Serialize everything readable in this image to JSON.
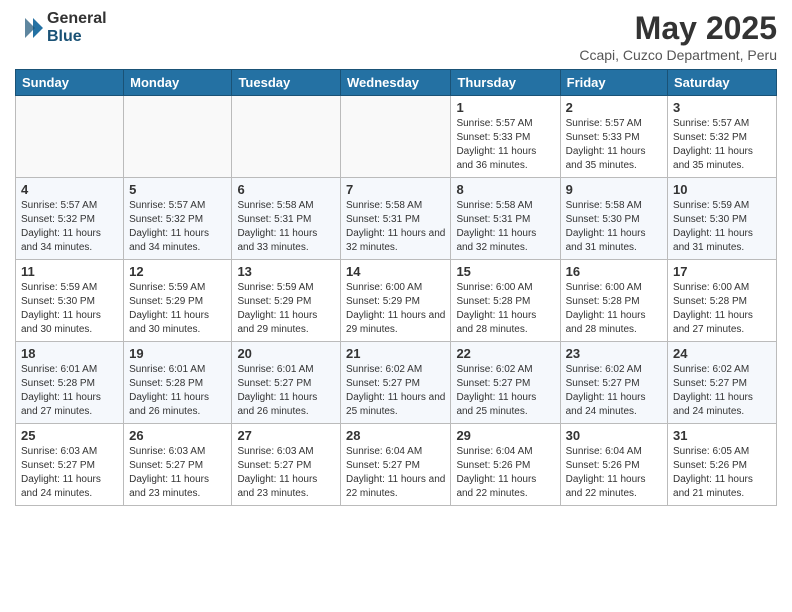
{
  "header": {
    "logo_general": "General",
    "logo_blue": "Blue",
    "month_title": "May 2025",
    "location": "Ccapi, Cuzco Department, Peru"
  },
  "weekdays": [
    "Sunday",
    "Monday",
    "Tuesday",
    "Wednesday",
    "Thursday",
    "Friday",
    "Saturday"
  ],
  "weeks": [
    [
      {
        "day": "",
        "info": ""
      },
      {
        "day": "",
        "info": ""
      },
      {
        "day": "",
        "info": ""
      },
      {
        "day": "",
        "info": ""
      },
      {
        "day": "1",
        "info": "Sunrise: 5:57 AM\nSunset: 5:33 PM\nDaylight: 11 hours\nand 36 minutes."
      },
      {
        "day": "2",
        "info": "Sunrise: 5:57 AM\nSunset: 5:33 PM\nDaylight: 11 hours\nand 35 minutes."
      },
      {
        "day": "3",
        "info": "Sunrise: 5:57 AM\nSunset: 5:32 PM\nDaylight: 11 hours\nand 35 minutes."
      }
    ],
    [
      {
        "day": "4",
        "info": "Sunrise: 5:57 AM\nSunset: 5:32 PM\nDaylight: 11 hours\nand 34 minutes."
      },
      {
        "day": "5",
        "info": "Sunrise: 5:57 AM\nSunset: 5:32 PM\nDaylight: 11 hours\nand 34 minutes."
      },
      {
        "day": "6",
        "info": "Sunrise: 5:58 AM\nSunset: 5:31 PM\nDaylight: 11 hours\nand 33 minutes."
      },
      {
        "day": "7",
        "info": "Sunrise: 5:58 AM\nSunset: 5:31 PM\nDaylight: 11 hours\nand 32 minutes."
      },
      {
        "day": "8",
        "info": "Sunrise: 5:58 AM\nSunset: 5:31 PM\nDaylight: 11 hours\nand 32 minutes."
      },
      {
        "day": "9",
        "info": "Sunrise: 5:58 AM\nSunset: 5:30 PM\nDaylight: 11 hours\nand 31 minutes."
      },
      {
        "day": "10",
        "info": "Sunrise: 5:59 AM\nSunset: 5:30 PM\nDaylight: 11 hours\nand 31 minutes."
      }
    ],
    [
      {
        "day": "11",
        "info": "Sunrise: 5:59 AM\nSunset: 5:30 PM\nDaylight: 11 hours\nand 30 minutes."
      },
      {
        "day": "12",
        "info": "Sunrise: 5:59 AM\nSunset: 5:29 PM\nDaylight: 11 hours\nand 30 minutes."
      },
      {
        "day": "13",
        "info": "Sunrise: 5:59 AM\nSunset: 5:29 PM\nDaylight: 11 hours\nand 29 minutes."
      },
      {
        "day": "14",
        "info": "Sunrise: 6:00 AM\nSunset: 5:29 PM\nDaylight: 11 hours\nand 29 minutes."
      },
      {
        "day": "15",
        "info": "Sunrise: 6:00 AM\nSunset: 5:28 PM\nDaylight: 11 hours\nand 28 minutes."
      },
      {
        "day": "16",
        "info": "Sunrise: 6:00 AM\nSunset: 5:28 PM\nDaylight: 11 hours\nand 28 minutes."
      },
      {
        "day": "17",
        "info": "Sunrise: 6:00 AM\nSunset: 5:28 PM\nDaylight: 11 hours\nand 27 minutes."
      }
    ],
    [
      {
        "day": "18",
        "info": "Sunrise: 6:01 AM\nSunset: 5:28 PM\nDaylight: 11 hours\nand 27 minutes."
      },
      {
        "day": "19",
        "info": "Sunrise: 6:01 AM\nSunset: 5:28 PM\nDaylight: 11 hours\nand 26 minutes."
      },
      {
        "day": "20",
        "info": "Sunrise: 6:01 AM\nSunset: 5:27 PM\nDaylight: 11 hours\nand 26 minutes."
      },
      {
        "day": "21",
        "info": "Sunrise: 6:02 AM\nSunset: 5:27 PM\nDaylight: 11 hours\nand 25 minutes."
      },
      {
        "day": "22",
        "info": "Sunrise: 6:02 AM\nSunset: 5:27 PM\nDaylight: 11 hours\nand 25 minutes."
      },
      {
        "day": "23",
        "info": "Sunrise: 6:02 AM\nSunset: 5:27 PM\nDaylight: 11 hours\nand 24 minutes."
      },
      {
        "day": "24",
        "info": "Sunrise: 6:02 AM\nSunset: 5:27 PM\nDaylight: 11 hours\nand 24 minutes."
      }
    ],
    [
      {
        "day": "25",
        "info": "Sunrise: 6:03 AM\nSunset: 5:27 PM\nDaylight: 11 hours\nand 24 minutes."
      },
      {
        "day": "26",
        "info": "Sunrise: 6:03 AM\nSunset: 5:27 PM\nDaylight: 11 hours\nand 23 minutes."
      },
      {
        "day": "27",
        "info": "Sunrise: 6:03 AM\nSunset: 5:27 PM\nDaylight: 11 hours\nand 23 minutes."
      },
      {
        "day": "28",
        "info": "Sunrise: 6:04 AM\nSunset: 5:27 PM\nDaylight: 11 hours\nand 22 minutes."
      },
      {
        "day": "29",
        "info": "Sunrise: 6:04 AM\nSunset: 5:26 PM\nDaylight: 11 hours\nand 22 minutes."
      },
      {
        "day": "30",
        "info": "Sunrise: 6:04 AM\nSunset: 5:26 PM\nDaylight: 11 hours\nand 22 minutes."
      },
      {
        "day": "31",
        "info": "Sunrise: 6:05 AM\nSunset: 5:26 PM\nDaylight: 11 hours\nand 21 minutes."
      }
    ]
  ]
}
